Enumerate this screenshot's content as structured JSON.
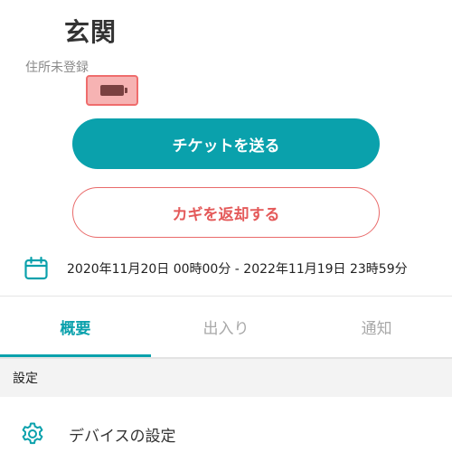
{
  "header": {
    "title": "玄関",
    "address": "住所未登録",
    "battery_icon": "battery-icon",
    "battery_status_color": "#ef6d6d"
  },
  "actions": {
    "send_ticket_label": "チケットを送る",
    "return_key_label": "カギを返却する"
  },
  "period": {
    "icon": "calendar-icon",
    "text": "2020年11月20日 00時00分 - 2022年11月19日 23時59分"
  },
  "tabs": [
    {
      "label": "概要",
      "active": true
    },
    {
      "label": "出入り",
      "active": false
    },
    {
      "label": "通知",
      "active": false
    }
  ],
  "settings": {
    "section_label": "設定",
    "items": [
      {
        "icon": "gear-icon",
        "label": "デバイスの設定"
      }
    ]
  },
  "colors": {
    "accent": "#0aa1ac",
    "danger": "#e45a5a"
  }
}
